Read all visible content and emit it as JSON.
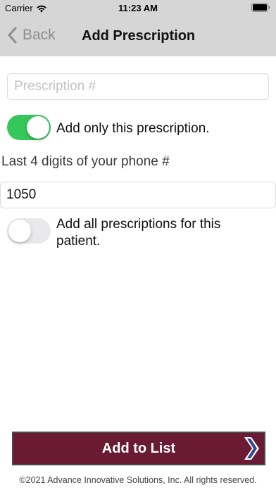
{
  "status_bar": {
    "carrier": "Carrier",
    "time": "11:23 AM"
  },
  "nav": {
    "back_label": "Back",
    "title": "Add Prescription"
  },
  "form": {
    "prescription_placeholder": "Prescription #",
    "prescription_value": "",
    "toggle_only_this": {
      "label": "Add only this prescription.",
      "on": true
    },
    "phone_label": "Last 4 digits of your phone #",
    "phone_value": "1050",
    "toggle_all": {
      "label": "Add all prescriptions for this patient.",
      "on": false
    }
  },
  "actions": {
    "add_to_list": "Add to List"
  },
  "footer": {
    "copyright": "©2021 Advance Innovative Solutions, Inc. All rights reserved."
  },
  "colors": {
    "nav_background": "#d6d6d6",
    "toggle_on": "#34c759",
    "button_background": "#6b1a33"
  }
}
